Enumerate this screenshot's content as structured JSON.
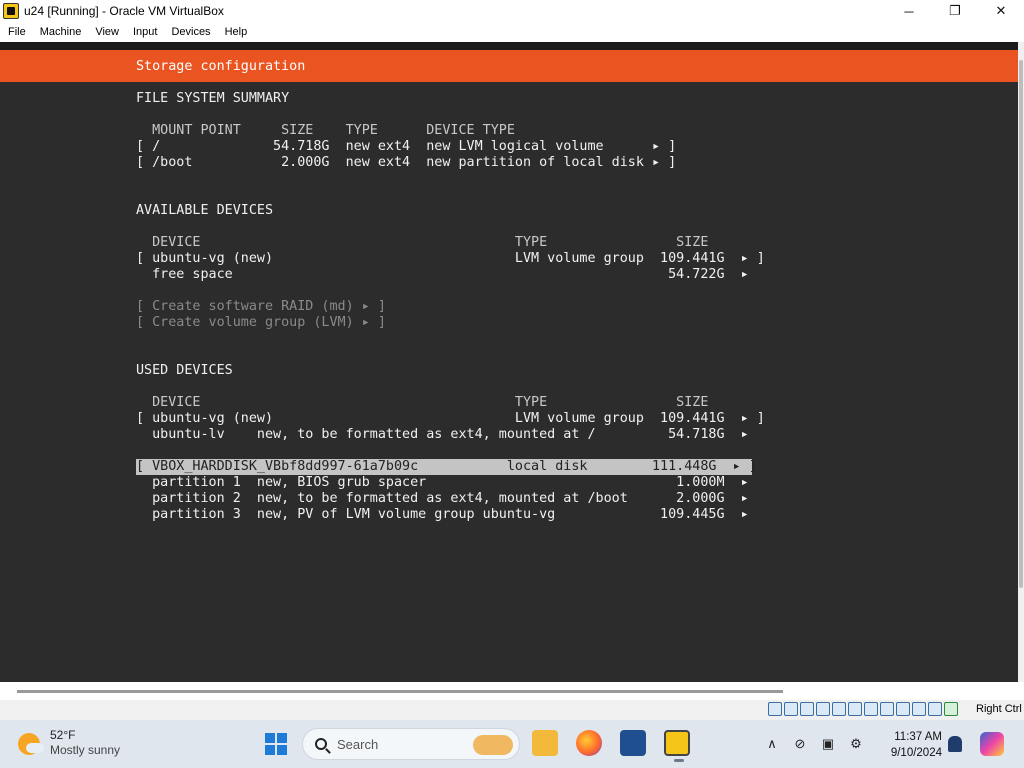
{
  "window": {
    "title": "u24 [Running] - Oracle VM VirtualBox",
    "controls": {
      "minimize": "─",
      "maximize": "❐",
      "close": "✕"
    }
  },
  "menu": [
    "File",
    "Machine",
    "View",
    "Input",
    "Devices",
    "Help"
  ],
  "installer": {
    "header": "Storage configuration",
    "fs_summary": {
      "title": "FILE SYSTEM SUMMARY",
      "columns": "  MOUNT POINT     SIZE    TYPE      DEVICE TYPE",
      "rows": [
        "[ /              54.718G  new ext4  new LVM logical volume      ▸ ]",
        "[ /boot           2.000G  new ext4  new partition of local disk ▸ ]"
      ]
    },
    "available": {
      "title": "AVAILABLE DEVICES",
      "columns": "  DEVICE                                       TYPE                SIZE",
      "rows": [
        "[ ubuntu-vg (new)                              LVM volume group  109.441G  ▸ ]",
        "  free space                                                      54.722G  ▸"
      ],
      "actions": [
        "[ Create software RAID (md) ▸ ]",
        "[ Create volume group (LVM) ▸ ]"
      ]
    },
    "used": {
      "title": "USED DEVICES",
      "columns": "  DEVICE                                       TYPE                SIZE",
      "rows": [
        "[ ubuntu-vg (new)                              LVM volume group  109.441G  ▸ ]",
        "  ubuntu-lv    new, to be formatted as ext4, mounted at /         54.718G  ▸"
      ],
      "selected_row": "[ VBOX_HARDDISK_VBbf8dd997-61a7b09c           local disk        111.448G  ▸ ]",
      "partitions": [
        "  partition 1  new, BIOS grub spacer                               1.000M  ▸",
        "  partition 2  new, to be formatted as ext4, mounted at /boot      2.000G  ▸",
        "  partition 3  new, PV of LVM volume group ubuntu-vg             109.445G  ▸"
      ]
    }
  },
  "statusbar": {
    "host_key": "Right Ctrl"
  },
  "taskbar": {
    "weather": {
      "temp": "52°F",
      "condition": "Mostly sunny"
    },
    "search_placeholder": "Search",
    "clock": {
      "time": "11:37 AM",
      "date": "9/10/2024"
    },
    "tray": {
      "chevron": "∧"
    }
  },
  "colors": {
    "accent": "#e95420",
    "console_bg": "#2c2c2c",
    "highlight": "#c4c4c4"
  }
}
